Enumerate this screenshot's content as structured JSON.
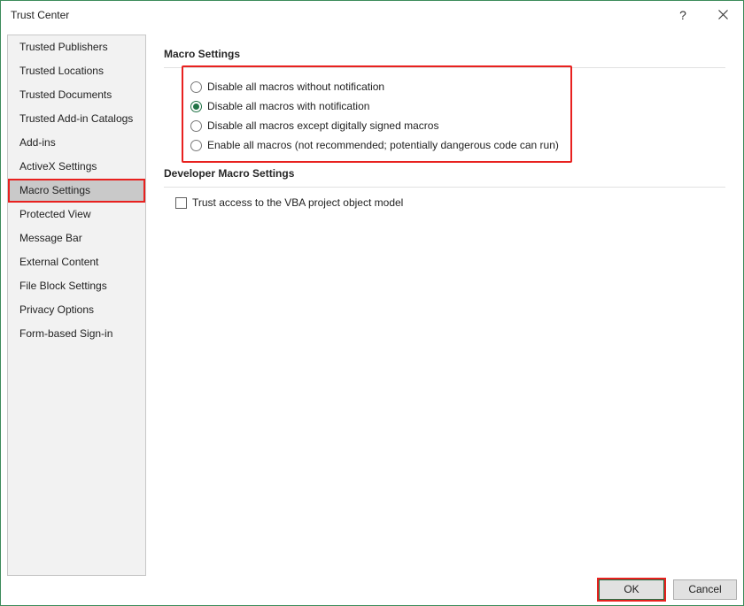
{
  "window": {
    "title": "Trust Center",
    "help_label": "?",
    "close_icon": "close-icon"
  },
  "sidebar": {
    "items": [
      {
        "label": "Trusted Publishers"
      },
      {
        "label": "Trusted Locations"
      },
      {
        "label": "Trusted Documents"
      },
      {
        "label": "Trusted Add-in Catalogs"
      },
      {
        "label": "Add-ins"
      },
      {
        "label": "ActiveX Settings"
      },
      {
        "label": "Macro Settings"
      },
      {
        "label": "Protected View"
      },
      {
        "label": "Message Bar"
      },
      {
        "label": "External Content"
      },
      {
        "label": "File Block Settings"
      },
      {
        "label": "Privacy Options"
      },
      {
        "label": "Form-based Sign-in"
      }
    ],
    "selected": "Macro Settings"
  },
  "macro_settings": {
    "header": "Macro Settings",
    "options": [
      {
        "label": "Disable all macros without notification",
        "checked": false
      },
      {
        "label": "Disable all macros with notification",
        "checked": true
      },
      {
        "label": "Disable all macros except digitally signed macros",
        "checked": false
      },
      {
        "label": "Enable all macros (not recommended; potentially dangerous code can run)",
        "checked": false
      }
    ]
  },
  "developer_macro_settings": {
    "header": "Developer Macro Settings",
    "vba_trust_label": "Trust access to the VBA project object model",
    "vba_trust_checked": false
  },
  "footer": {
    "ok_label": "OK",
    "cancel_label": "Cancel"
  },
  "colors": {
    "accent": "#217346",
    "highlight": "#e8211f"
  }
}
